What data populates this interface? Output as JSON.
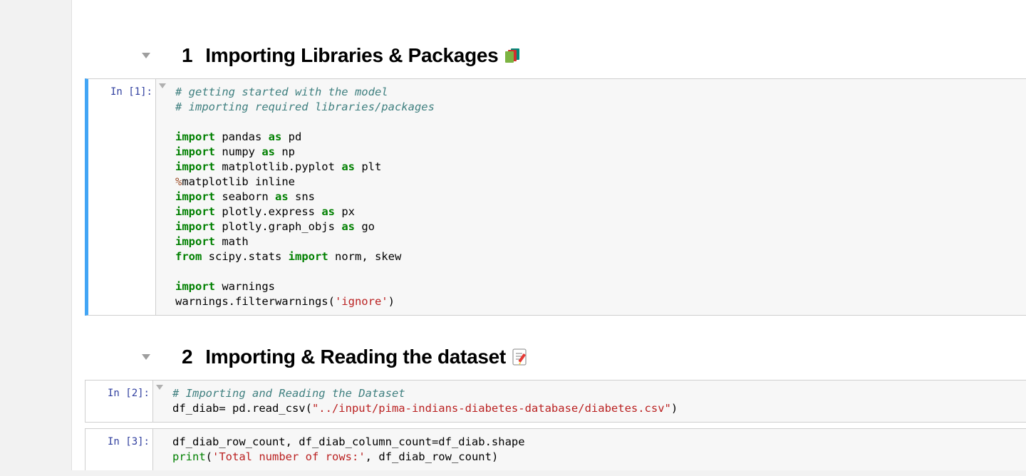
{
  "sections": {
    "s1": {
      "number": "1",
      "title": "Importing Libraries & Packages",
      "icon": "books"
    },
    "s2": {
      "number": "2",
      "title": "Importing & Reading the dataset",
      "icon": "pencil-paper"
    }
  },
  "cells": {
    "c1": {
      "prompt": "In [1]:",
      "selected": true,
      "code": {
        "l01": "# getting started with the model",
        "l02": "# importing required libraries/packages",
        "l03": "",
        "l04_kw1": "import",
        "l04_nm": " pandas ",
        "l04_kw2": "as",
        "l04_nm2": " pd",
        "l05_kw1": "import",
        "l05_nm": " numpy ",
        "l05_kw2": "as",
        "l05_nm2": " np",
        "l06_kw1": "import",
        "l06_nm": " matplotlib.pyplot ",
        "l06_kw2": "as",
        "l06_nm2": " plt",
        "l07_mg": "%",
        "l07_txt": "matplotlib inline",
        "l08_kw1": "import",
        "l08_nm": " seaborn ",
        "l08_kw2": "as",
        "l08_nm2": " sns",
        "l09_kw1": "import",
        "l09_nm": " plotly.express ",
        "l09_kw2": "as",
        "l09_nm2": " px",
        "l10_kw1": "import",
        "l10_nm": " plotly.graph_objs ",
        "l10_kw2": "as",
        "l10_nm2": " go",
        "l11_kw1": "import",
        "l11_nm": " math",
        "l12_kw1": "from",
        "l12_nm": " scipy.stats ",
        "l12_kw2": "import",
        "l12_nm2": " norm, skew",
        "l13": "",
        "l14_kw1": "import",
        "l14_nm": " warnings",
        "l15_a": "warnings.filterwarnings(",
        "l15_s": "'ignore'",
        "l15_b": ")"
      }
    },
    "c2": {
      "prompt": "In [2]:",
      "selected": false,
      "code": {
        "l01": "# Importing and Reading the Dataset",
        "l02_a": "df_diab= pd.read_csv(",
        "l02_s": "\"../input/pima-indians-diabetes-database/diabetes.csv\"",
        "l02_b": ")"
      }
    },
    "c3": {
      "prompt": "In [3]:",
      "selected": false,
      "code": {
        "l01": "df_diab_row_count, df_diab_column_count=df_diab.shape",
        "l02_bi": "print",
        "l02_a": "(",
        "l02_s": "'Total number of rows:'",
        "l02_b": ", df_diab_row_count)"
      }
    }
  }
}
